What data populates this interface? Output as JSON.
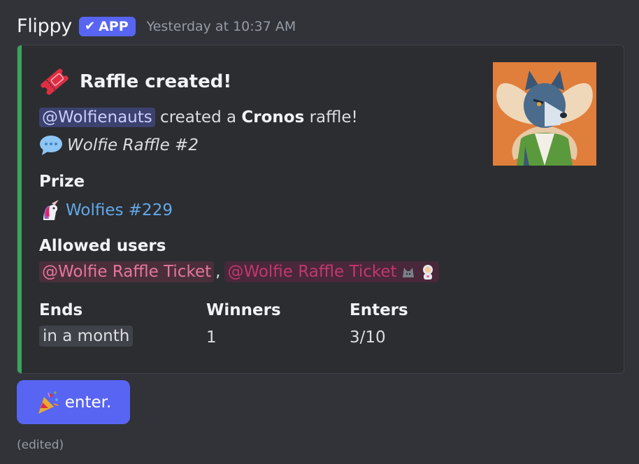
{
  "message": {
    "author": "Flippy",
    "badge": "APP",
    "timestamp": "Yesterday at 10:37 AM",
    "edited": "(edited)"
  },
  "embed": {
    "accent_color": "#3ba55c",
    "title": "Raffle created!",
    "title_icon": "ticket-icon",
    "mention": "@Wolfienauts",
    "desc_created": " created a ",
    "desc_bold": "Cronos",
    "desc_tail": " raffle!",
    "raffle_name": "Wolfie Raffle #2",
    "prize_label": "Prize",
    "prize_value": "Wolfies #229",
    "allowed_label": "Allowed users",
    "role_1": "@Wolfie Raffle Ticket",
    "separator": ",",
    "role_2": "@Wolfie Raffle Ticket",
    "ends_label": "Ends",
    "ends_value": "in a month",
    "winners_label": "Winners",
    "winners_value": "1",
    "enters_label": "Enters",
    "enters_value": "3/10"
  },
  "button": {
    "label": "enter.",
    "icon": "party-popper-icon",
    "color": "#5865f2"
  }
}
